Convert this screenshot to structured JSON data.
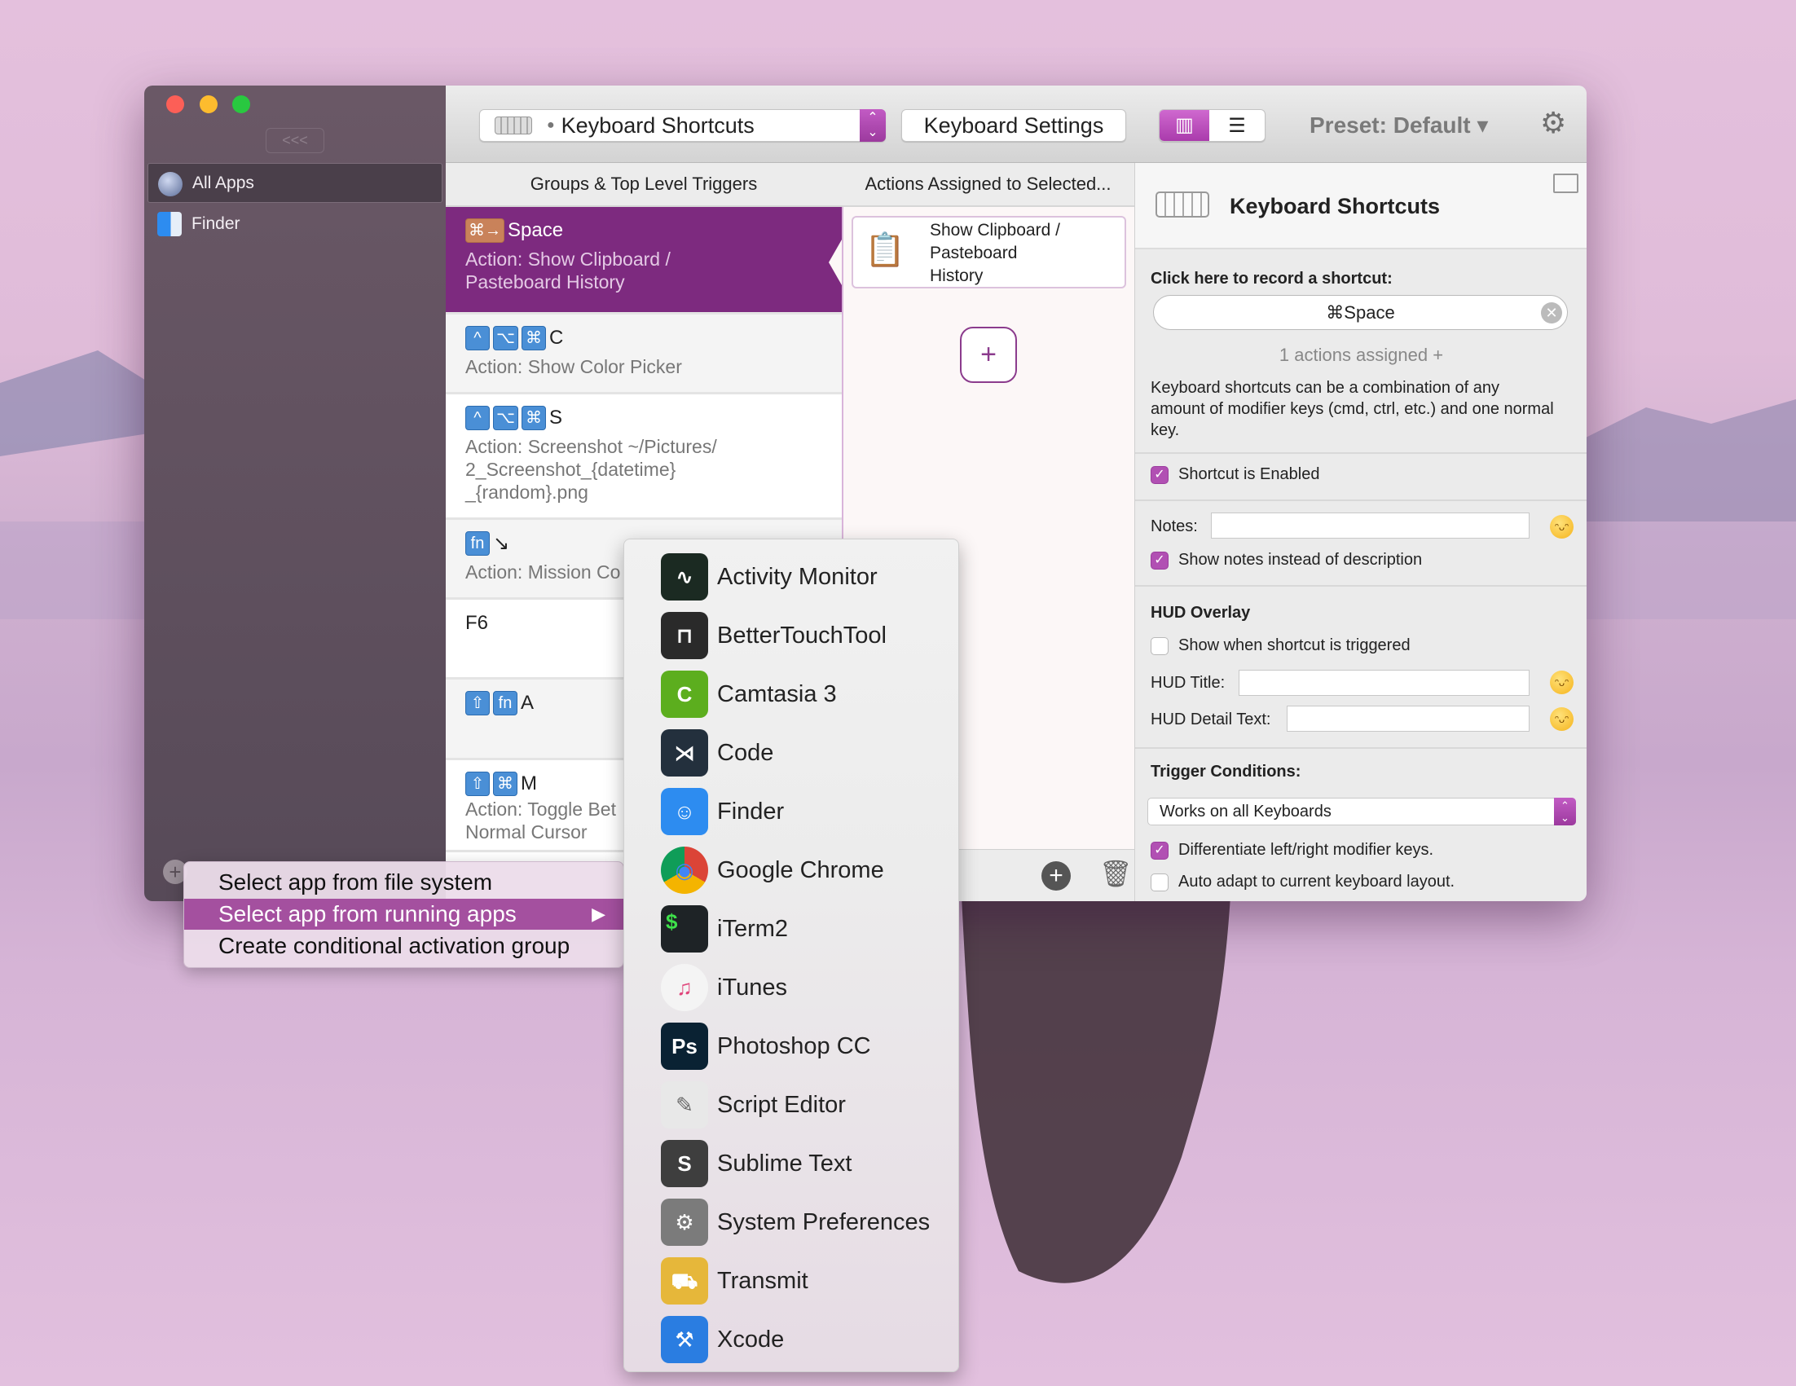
{
  "colors": {
    "accent": "#7d2a7f",
    "accent_light": "#b150b3",
    "menu_highlight": "#a4509f",
    "key_badge": "#4a8fd6",
    "trigger_badge": "#c9825a"
  },
  "sidebar": {
    "collapse_label": "<<<",
    "items": [
      {
        "label": "All Apps",
        "icon": "globe-icon",
        "selected": true
      },
      {
        "label": "Finder",
        "icon": "finder-icon",
        "selected": false
      }
    ]
  },
  "toolbar": {
    "trigger_type": "Keyboard Shortcuts",
    "keyboard_settings": "Keyboard Settings",
    "preset": "Preset: Default ▾",
    "view_modes": [
      "columns-view-icon",
      "list-view-icon"
    ],
    "active_view": "columns"
  },
  "columns": {
    "groups_header": "Groups & Top Level Triggers",
    "actions_header": "Actions Assigned to Selected..."
  },
  "groups": [
    {
      "keys": [
        "⌘→"
      ],
      "key": "Space",
      "desc": [
        "Action: Show Clipboard /",
        "Pasteboard History"
      ],
      "selected": true
    },
    {
      "keys": [
        "^",
        "⌥",
        "⌘"
      ],
      "key": "C",
      "desc": [
        "Action: Show Color Picker"
      ]
    },
    {
      "keys": [
        "^",
        "⌥",
        "⌘"
      ],
      "key": "S",
      "desc": [
        "Action: Screenshot ~/Pictures/",
        "2_Screenshot_{datetime}",
        "_{random}.png"
      ]
    },
    {
      "keys": [
        "fn"
      ],
      "key": "↘",
      "desc": [
        "Action: Mission Co"
      ]
    },
    {
      "keys": [],
      "key": "F6",
      "desc": []
    },
    {
      "keys": [
        "⇧",
        "fn"
      ],
      "key": "A",
      "desc": []
    },
    {
      "keys": [
        "⇧",
        "⌘"
      ],
      "key": "M",
      "desc": [
        "Action: Toggle Bet",
        "Normal Cursor"
      ]
    }
  ],
  "actions": {
    "items": [
      {
        "label_lines": [
          "Show Clipboard /",
          "Pasteboard",
          "History"
        ],
        "icon": "clipboard-icon"
      }
    ],
    "add_label": "+"
  },
  "panel": {
    "title": "Keyboard Shortcuts",
    "record_label": "Click here to record a shortcut:",
    "shortcut_value": "⌘Space",
    "actions_assigned": "1 actions assigned +",
    "description": "Keyboard shortcuts can be a combination of any amount of modifier keys (cmd, ctrl, etc.) and one normal key.",
    "enabled_label": "Shortcut is Enabled",
    "enabled": true,
    "notes_label": "Notes:",
    "notes_value": "",
    "show_notes_label": "Show notes instead of description",
    "show_notes": true,
    "hud_header": "HUD Overlay",
    "hud_show_label": "Show when shortcut is triggered",
    "hud_show": false,
    "hud_title_label": "HUD Title:",
    "hud_title_value": "",
    "hud_detail_label": "HUD Detail Text:",
    "hud_detail_value": "",
    "trigger_header": "Trigger Conditions:",
    "keyboard_select": "Works on all Keyboards",
    "differentiate_label": "Differentiate left/right modifier keys.",
    "differentiate": true,
    "auto_adapt_label": "Auto adapt to current keyboard layout.",
    "auto_adapt": false
  },
  "context_menu": {
    "items": [
      {
        "label": "Select app from file system"
      },
      {
        "label": "Select app from running apps",
        "highlighted": true,
        "submenu": true
      },
      {
        "label": "Create conditional activation group"
      }
    ]
  },
  "running_apps": [
    {
      "name": "Activity Monitor",
      "icon": "activity-monitor-icon",
      "color": "#1b2a22"
    },
    {
      "name": "BetterTouchTool",
      "icon": "bettertouchtool-icon",
      "color": "#2a2a2a"
    },
    {
      "name": "Camtasia 3",
      "icon": "camtasia-icon",
      "color": "#5cae1e"
    },
    {
      "name": "Code",
      "icon": "vscode-icon",
      "color": "#23303d"
    },
    {
      "name": "Finder",
      "icon": "finder-icon",
      "color": "#2d8cf0"
    },
    {
      "name": "Google Chrome",
      "icon": "chrome-icon",
      "color": "#db4437"
    },
    {
      "name": "iTerm2",
      "icon": "iterm-icon",
      "color": "#1e2326"
    },
    {
      "name": "iTunes",
      "icon": "itunes-icon",
      "color": "#f4f4f4"
    },
    {
      "name": "Photoshop CC",
      "icon": "photoshop-icon",
      "color": "#0a2233"
    },
    {
      "name": "Script Editor",
      "icon": "script-editor-icon",
      "color": "#e8e8e8"
    },
    {
      "name": "Sublime Text",
      "icon": "sublime-icon",
      "color": "#3e3e3e"
    },
    {
      "name": "System Preferences",
      "icon": "system-preferences-icon",
      "color": "#7b7b7b"
    },
    {
      "name": "Transmit",
      "icon": "transmit-icon",
      "color": "#e6b73a"
    },
    {
      "name": "Xcode",
      "icon": "xcode-icon",
      "color": "#2a7de1"
    }
  ]
}
